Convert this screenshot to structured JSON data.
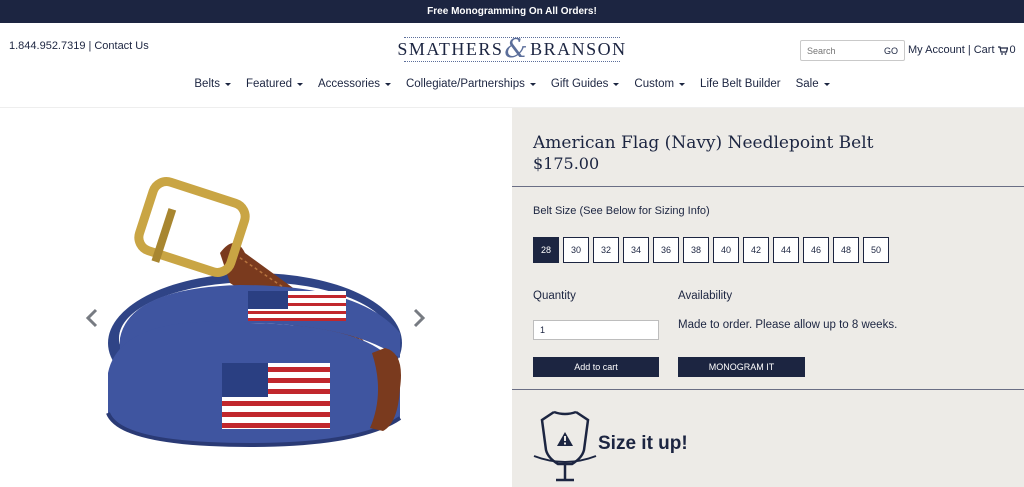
{
  "promo": {
    "text": "Free Monogramming On All Orders!"
  },
  "header": {
    "phone": "1.844.952.7319",
    "separator": "|",
    "contact_label": "Contact Us",
    "logo_left": "SMATHERS",
    "logo_amp": "&",
    "logo_right": "BRANSON",
    "search_placeholder": "Search",
    "search_go": "GO",
    "account_label": "My Account",
    "cart_label": "Cart",
    "cart_count": "0"
  },
  "nav": {
    "items": [
      {
        "label": "Belts",
        "dropdown": true
      },
      {
        "label": "Featured",
        "dropdown": true
      },
      {
        "label": "Accessories",
        "dropdown": true
      },
      {
        "label": "Collegiate/Partnerships",
        "dropdown": true
      },
      {
        "label": "Gift Guides",
        "dropdown": true
      },
      {
        "label": "Custom",
        "dropdown": true
      },
      {
        "label": "Life Belt Builder",
        "dropdown": false
      },
      {
        "label": "Sale",
        "dropdown": true
      }
    ]
  },
  "product": {
    "title": "American Flag (Navy) Needlepoint Belt",
    "price": "$175.00",
    "size_label": "Belt Size (See Below for Sizing Info)",
    "sizes": [
      "28",
      "30",
      "32",
      "34",
      "36",
      "38",
      "40",
      "42",
      "44",
      "46",
      "48",
      "50"
    ],
    "selected_size": "28",
    "quantity_label": "Quantity",
    "quantity_value": "1",
    "availability_label": "Availability",
    "availability_text": "Made to order. Please allow up to 8 weeks.",
    "add_to_cart": "Add to cart",
    "monogram": "MONOGRAM IT",
    "size_it_up": "Size it up!"
  },
  "colors": {
    "navy": "#1c2541",
    "panel_bg": "#edebe7",
    "belt_blue": "#3f55a0",
    "leather": "#7a3a1e",
    "brass": "#c9a544"
  },
  "icons": [
    "cart-icon",
    "chevron-left-icon",
    "chevron-right-icon",
    "mannequin-icon"
  ]
}
